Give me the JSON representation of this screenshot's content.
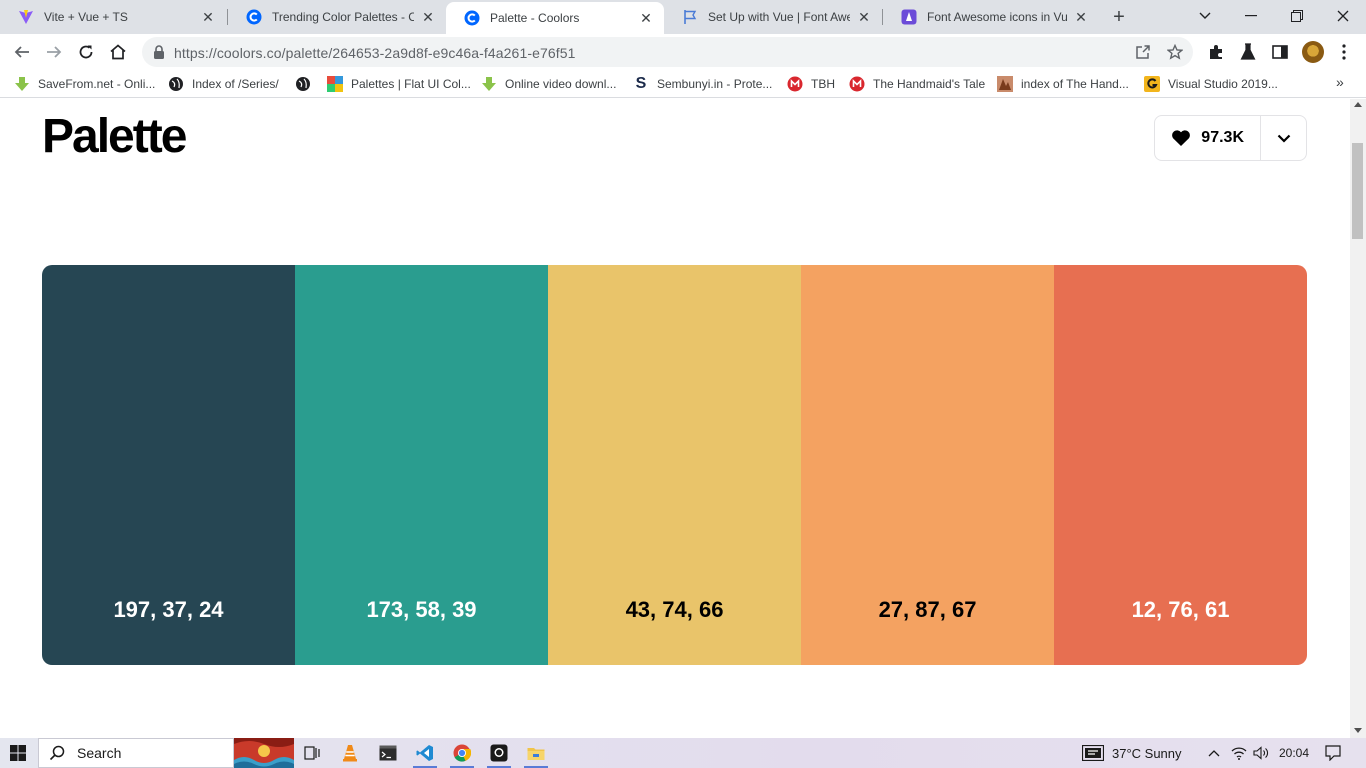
{
  "browser": {
    "tabs": [
      {
        "title": "Vite + Vue + TS",
        "icon": "vite-icon",
        "active": false
      },
      {
        "title": "Trending Color Palettes - Coo",
        "icon": "coolors-icon",
        "active": false
      },
      {
        "title": "Palette - Coolors",
        "icon": "coolors-icon",
        "active": true
      },
      {
        "title": "Set Up with Vue | Font Aweso",
        "icon": "flag-icon",
        "active": false
      },
      {
        "title": "Font Awesome icons in Vue.j",
        "icon": "font-awesome-icon",
        "active": false
      }
    ],
    "url_host": "https://coolors.co",
    "url_path": "/palette/264653-2a9d8f-e9c46a-f4a261-e76f51",
    "bookmarks": [
      {
        "label": "SaveFrom.net - Onli...",
        "icon": "savefrom-icon"
      },
      {
        "label": "Index of /Series/",
        "icon": "globe-icon"
      },
      {
        "label": "",
        "icon": "globe-icon"
      },
      {
        "label": "Palettes | Flat UI Col...",
        "icon": "flatui-icon"
      },
      {
        "label": "Online video downl...",
        "icon": "savefrom-icon"
      },
      {
        "label": "Sembunyi.in - Prote...",
        "icon": "sembunyi-icon"
      },
      {
        "label": "TBH",
        "icon": "mega-icon"
      },
      {
        "label": "The Handmaid's Tale",
        "icon": "mega-icon"
      },
      {
        "label": "index of The Hand...",
        "icon": "site-icon"
      },
      {
        "label": "Visual Studio 2019...",
        "icon": "g-icon"
      }
    ]
  },
  "page": {
    "title": "Palette",
    "likes": "97.3K",
    "palette": [
      {
        "hex": "#264653",
        "label": "197, 37, 24",
        "text_color": "#ffffff"
      },
      {
        "hex": "#2a9d8f",
        "label": "173, 58, 39",
        "text_color": "#ffffff"
      },
      {
        "hex": "#e9c46a",
        "label": "43, 74, 66",
        "text_color": "#000000"
      },
      {
        "hex": "#f4a261",
        "label": "27, 87, 67",
        "text_color": "#000000"
      },
      {
        "hex": "#e76f51",
        "label": "12, 76, 61",
        "text_color": "#ffffff"
      }
    ]
  },
  "taskbar": {
    "search_label": "Search",
    "weather": "37°C  Sunny",
    "time": "20:04"
  }
}
